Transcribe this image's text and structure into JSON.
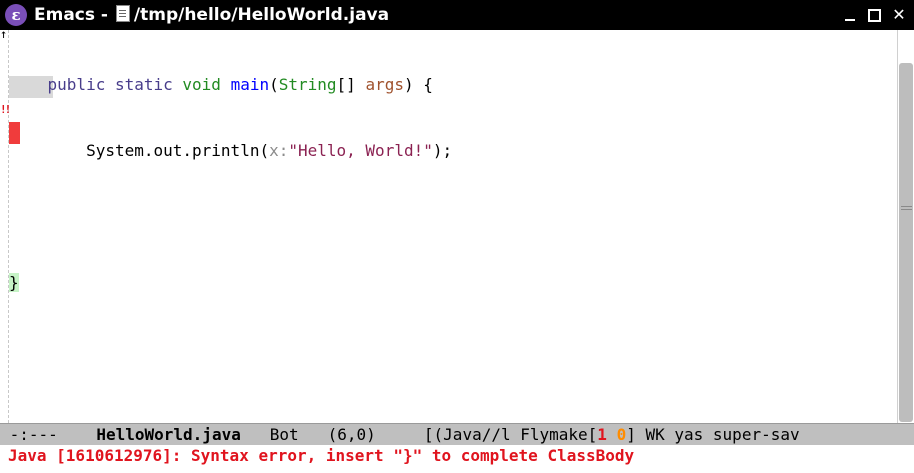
{
  "window": {
    "app_name": "Emacs -",
    "file_path": "/tmp/hello/HelloWorld.java"
  },
  "code": {
    "line1": {
      "indent": "    ",
      "kw1": "public",
      "kw2": "static",
      "kw3": "void",
      "fn": "main",
      "paren_open": "(",
      "type": "String",
      "brackets": "[] ",
      "var": "args",
      "rest": ") {"
    },
    "line2": {
      "indent": "        ",
      "call": "System.out.println(",
      "hint": "x:",
      "string": "\"Hello, World!\"",
      "rest": ");"
    },
    "line4": {
      "brace": "}"
    }
  },
  "fringe": {
    "arrow": "↑",
    "error_mark": "!!"
  },
  "modeline": {
    "status": "-:---",
    "buffer_name": "HelloWorld.java",
    "position": "Bot",
    "line_col": "(6,0)",
    "mode_prefix": "[(Java//l Flymake[",
    "flymake_errors": "1",
    "flymake_warnings": "0",
    "mode_suffix": "] WK yas super-sav"
  },
  "echo": {
    "message": "Java [1610612976]: Syntax error, insert \"}\" to complete ClassBody"
  },
  "colors": {
    "accent": "#7a4fb8",
    "error": "#e0141e",
    "warning": "#ff8c00"
  },
  "icons": {
    "app": "emacs-icon",
    "doc": "document-icon",
    "minimize": "minimize-icon",
    "maximize": "maximize-icon",
    "close": "close-icon"
  }
}
